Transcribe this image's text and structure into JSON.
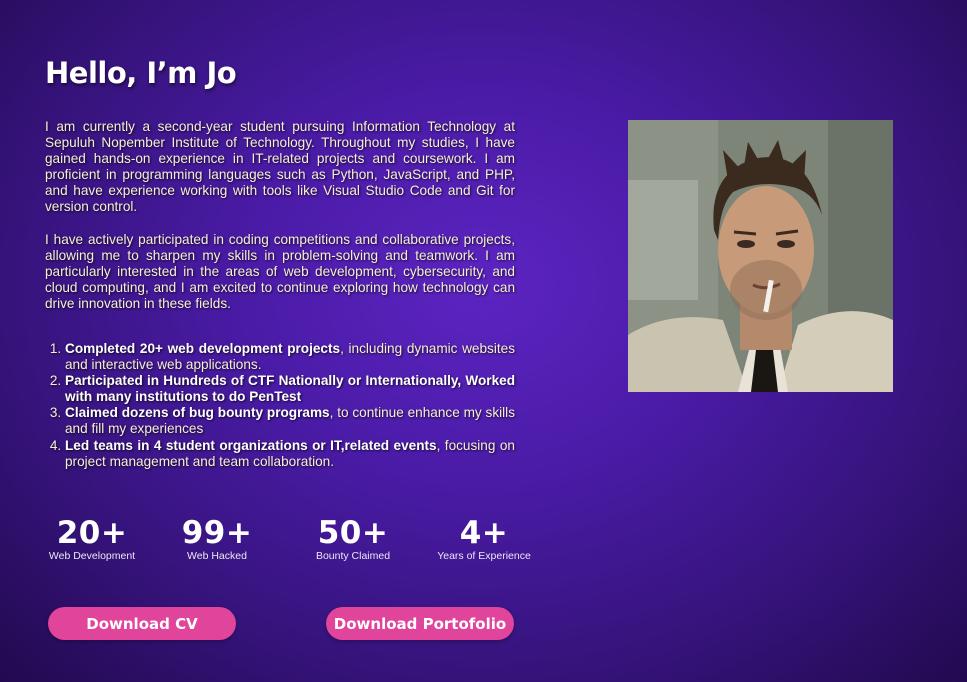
{
  "hero": {
    "title": "Hello, I’m Jo",
    "paragraph_1": "I am currently a second-year student pursuing Information Technology at Sepuluh Nopember Institute of Technology. Throughout my studies, I have gained hands-on experience in IT-related projects and coursework. I am proficient in programming languages such as Python, JavaScript, and PHP, and have experience working with tools like Visual Studio Code and Git for version control.",
    "paragraph_2": "I have actively participated in coding competitions and collaborative projects, allowing me to sharpen my skills in problem-solving and teamwork. I am particularly interested in the areas of web development, cybersecurity, and cloud computing, and I am excited to continue exploring how technology can drive innovation in these fields."
  },
  "achievements": [
    {
      "bold": "Completed 20+ web development projects",
      "rest": ", including dynamic websites and interactive web applications."
    },
    {
      "bold": "Participated in Hundreds of CTF Nationally or Internationally, Worked with many institutions to do PenTest",
      "rest": ""
    },
    {
      "bold": "Claimed dozens of bug bounty programs",
      "rest": ", to continue enhance my skills and fill my experiences"
    },
    {
      "bold": "Led teams in 4 student organizations or IT,related events",
      "rest": ", focusing on project management and team collaboration."
    }
  ],
  "stats": [
    {
      "value": "20+",
      "label": "Web Development"
    },
    {
      "value": "99+",
      "label": "Web Hacked"
    },
    {
      "value": "50+",
      "label": "Bounty Claimed"
    },
    {
      "value": "4+",
      "label": "Years of Experience"
    }
  ],
  "buttons": {
    "download_cv": "Download CV",
    "download_portfolio": "Download Portofolio"
  },
  "colors": {
    "background": "#4a1ba6",
    "button": "#e0449b",
    "body_text": "#f6efd8"
  }
}
